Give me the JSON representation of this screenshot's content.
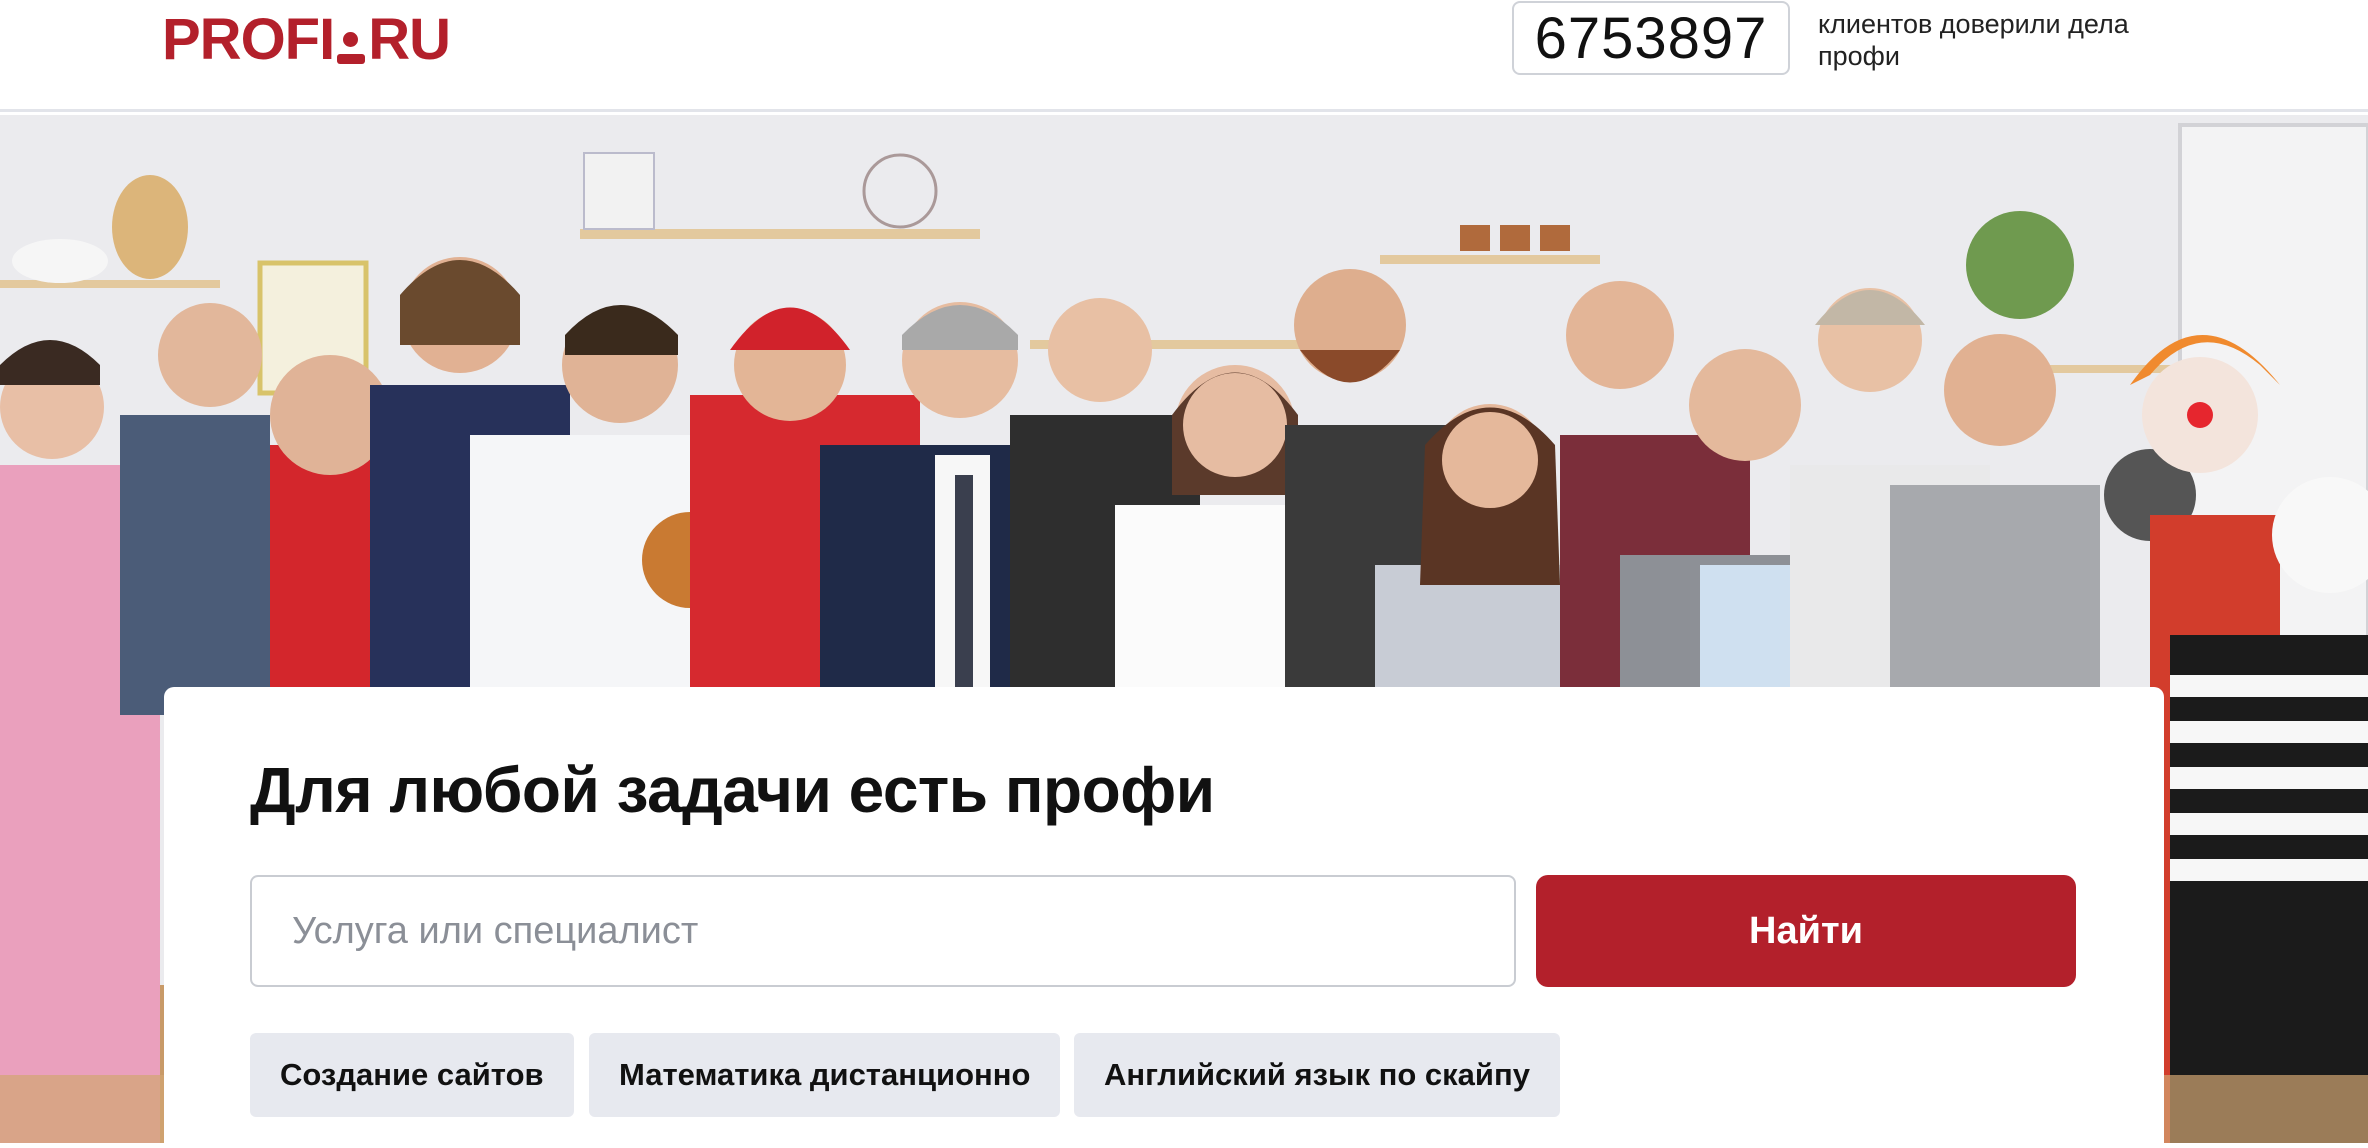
{
  "header": {
    "logo_text": "PROFI.RU",
    "counter": "6753897",
    "counter_caption": "клиентов доверили дела профи"
  },
  "hero": {
    "title": "Для любой задачи есть профи",
    "search": {
      "placeholder": "Услуга или специалист",
      "value": ""
    },
    "search_button_label": "Найти",
    "suggestions": [
      "Создание сайтов",
      "Математика дистанционно",
      "Английский язык по скайпу"
    ]
  },
  "colors": {
    "brand": "#b3202b",
    "chip_bg": "#e7e9ef",
    "card_bg": "#ffffff"
  }
}
